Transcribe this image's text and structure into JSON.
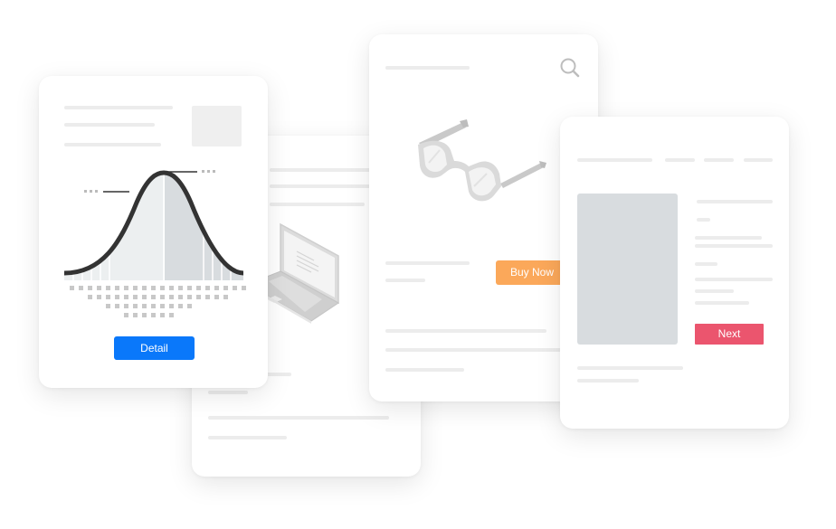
{
  "illustration": "Mock UI cards",
  "cards": {
    "chart_card": {
      "button_label": "Detail",
      "button_color": "#0a78fa",
      "icons": {
        "curve": "bell-curve-icon"
      }
    },
    "laptop_card": {
      "icons": {
        "device": "laptop-icon"
      }
    },
    "product_card": {
      "button_label": "Buy Now",
      "button_color": "#fba85a",
      "icons": {
        "search": "search-icon",
        "product": "glasses-icon"
      }
    },
    "next_card": {
      "button_label": "Next",
      "button_color": "#eb556e",
      "image_placeholder_color": "#d8dcdf"
    }
  }
}
